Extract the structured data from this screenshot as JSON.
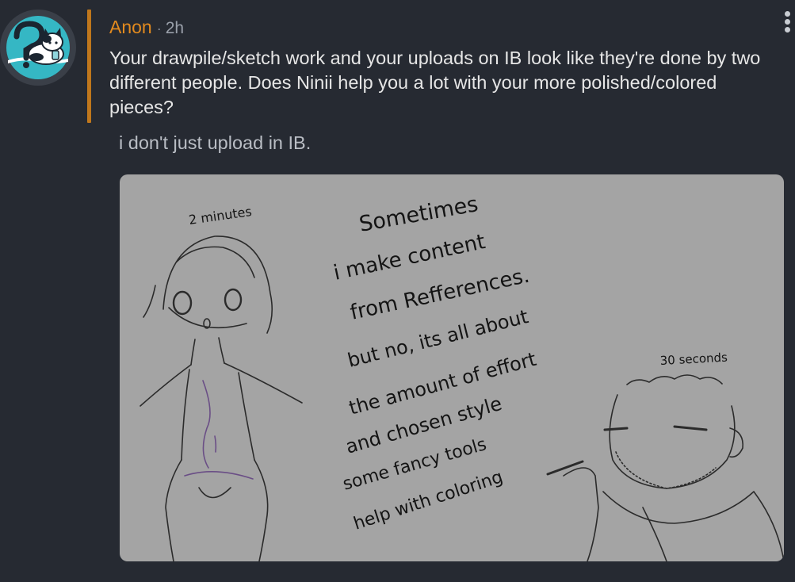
{
  "post": {
    "author": "Anon",
    "separator": "·",
    "time": "2h",
    "question": "Your drawpile/sketch work and your uploads on IB look like they're done by two different people. Does Ninii help you a lot with your more polished/colored pieces?",
    "reply": "i don't just upload in IB."
  },
  "attachment": {
    "label_left": "2 minutes",
    "label_right": "30 seconds",
    "lines": [
      "Sometimes",
      "i make content",
      "from Refferences.",
      "but no, its all about",
      "the amount of effort",
      "and chosen style",
      "some fancy tools",
      "help with coloring"
    ]
  },
  "colors": {
    "background": "#262a32",
    "author": "#e38a1e",
    "quote_bar": "#c0771c",
    "question_text": "#e6e6e6",
    "reply_text": "#b9bdc4",
    "avatar_teal": "#35b7c4",
    "sketch_bg": "#a4a4a4"
  },
  "icons": {
    "avatar": "cat-avatar-icon",
    "menu": "kebab-menu-icon"
  }
}
